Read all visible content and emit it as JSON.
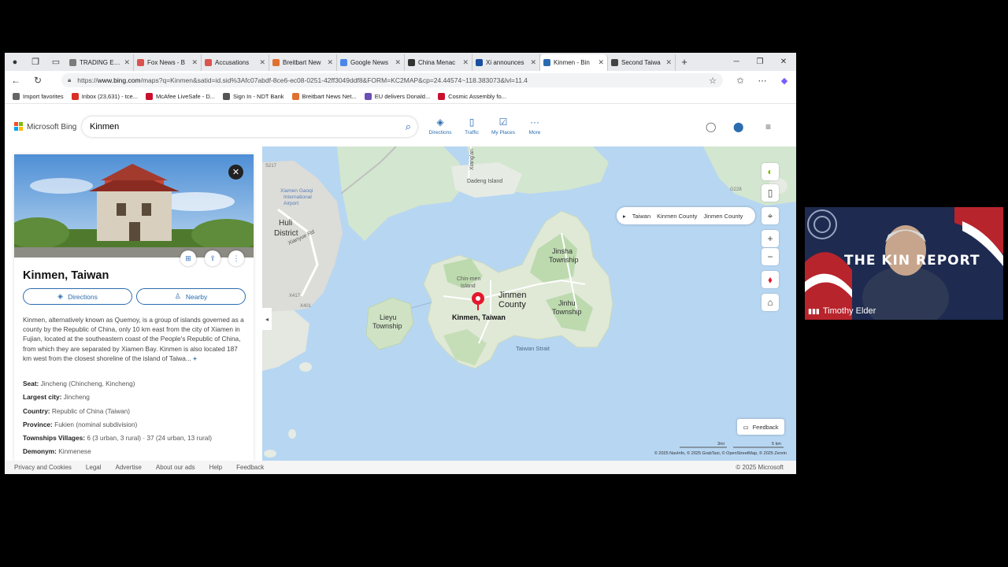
{
  "browser": {
    "tabs": [
      {
        "label": "TRADING ECO",
        "color": "#7b7b7b"
      },
      {
        "label": "Fox News - B",
        "color": "#d9534f"
      },
      {
        "label": "Accusations",
        "color": "#d9534f"
      },
      {
        "label": "Breitbart New",
        "color": "#e07030"
      },
      {
        "label": "Google News",
        "color": "#4a86e8"
      },
      {
        "label": "China Menac",
        "color": "#333333"
      },
      {
        "label": "Xi announces",
        "color": "#1a4fa0"
      },
      {
        "label": "Kinmen - Bin",
        "color": "#2b6cb0"
      },
      {
        "label": "Second Taiwa",
        "color": "#444444"
      }
    ],
    "url_prefix": "https://",
    "url_domain": "www.bing.com",
    "url_rest": "/maps?q=Kinmen&satid=id.sid%3Afc07abdf-8ce6-ec08-0251-42ff3049ddf8&FORM=KC2MAP&cp=24.44574~118.383073&lvl=11.4",
    "favorites": [
      {
        "label": "Import favorites",
        "color": "#666666"
      },
      {
        "label": "Inbox (23,631) - tce...",
        "color": "#d93025"
      },
      {
        "label": "McAfee LiveSafe - D...",
        "color": "#c8102e"
      },
      {
        "label": "Sign In - NDT Bank",
        "color": "#555555"
      },
      {
        "label": "Breitbart News Net...",
        "color": "#e07030"
      },
      {
        "label": "EU delivers Donald...",
        "color": "#6a4fb5"
      },
      {
        "label": "Cosmic Assembly fo...",
        "color": "#c8102e"
      }
    ]
  },
  "bing": {
    "logo_text": "Microsoft Bing",
    "search_value": "Kinmen",
    "tools": [
      {
        "label": "Directions",
        "icon": "◈"
      },
      {
        "label": "Traffic",
        "icon": "▯"
      },
      {
        "label": "My Places",
        "icon": "☑"
      },
      {
        "label": "More",
        "icon": "···"
      }
    ]
  },
  "panel": {
    "title": "Kinmen, Taiwan",
    "directions_label": "Directions",
    "nearby_label": "Nearby",
    "description": "Kinmen, alternatively known as Quemoy, is a group of islands governed as a county by the Republic of China, only 10 km east from the city of Xiamen in Fujian, located at the southeastern coast of the People's Republic of China, from which they are separated by Xiamen Bay. Kinmen is also located 187 km west from the closest shoreline of the island of Taiwa...",
    "more": "+",
    "facts": [
      {
        "key": "Seat:",
        "value": "Jincheng (Chincheng, Kincheng)"
      },
      {
        "key": "Largest city:",
        "value": "Jincheng"
      },
      {
        "key": "Country:",
        "value": "Republic of China (Taiwan)"
      },
      {
        "key": "Province:",
        "value": "Fukien (nominal subdivision)"
      },
      {
        "key": "Townships Villages:",
        "value": "6 (3 urban, 3 rural) · 37 (24 urban, 13 rural)"
      },
      {
        "key": "Demonym:",
        "value": "Kinmenese"
      }
    ]
  },
  "map": {
    "labels": {
      "huli": "Huli",
      "district": "District",
      "xianyue": "Xianyue Rd",
      "dadeng": "Dadeng Island",
      "xiangan": "Xiang'an",
      "jinsha": "Jinsha",
      "township1": "Township",
      "chinmen": "Chin-men",
      "island": "Island",
      "jinmen": "Jinmen",
      "county": "County",
      "jinhu": "Jinhu",
      "township2": "Township",
      "lieyu": "Lieyu",
      "township3": "Township",
      "kinmen": "Kinmen, Taiwan",
      "strait": "Taiwan Strait",
      "xiamen_airport": "Xiamen Gaoqi",
      "xiamen_airport2": "International",
      "xiamen_airport3": "Airport",
      "r_s217": "S217",
      "r_x417": "X417",
      "r_x401": "X401",
      "r_g228": "G228"
    },
    "breadcrumb": [
      "Taiwan",
      "Kinmen County",
      "Jinmen County"
    ],
    "feedback_label": "Feedback",
    "scale_mi": "3mi",
    "scale_km": "5 km",
    "copyright": "© 2025 NavInfo, © 2025 GrabTaxi, © OpenStreetMap, © 2025 Zenrin",
    "pin_color": "#e3182d"
  },
  "footer": {
    "links": [
      "Privacy and Cookies",
      "Legal",
      "Advertise",
      "About our ads",
      "Help",
      "Feedback"
    ],
    "copyright": "© 2025 Microsoft"
  },
  "webcam": {
    "banner": "THE KIN      REPORT",
    "name": "Timothy Elder"
  }
}
